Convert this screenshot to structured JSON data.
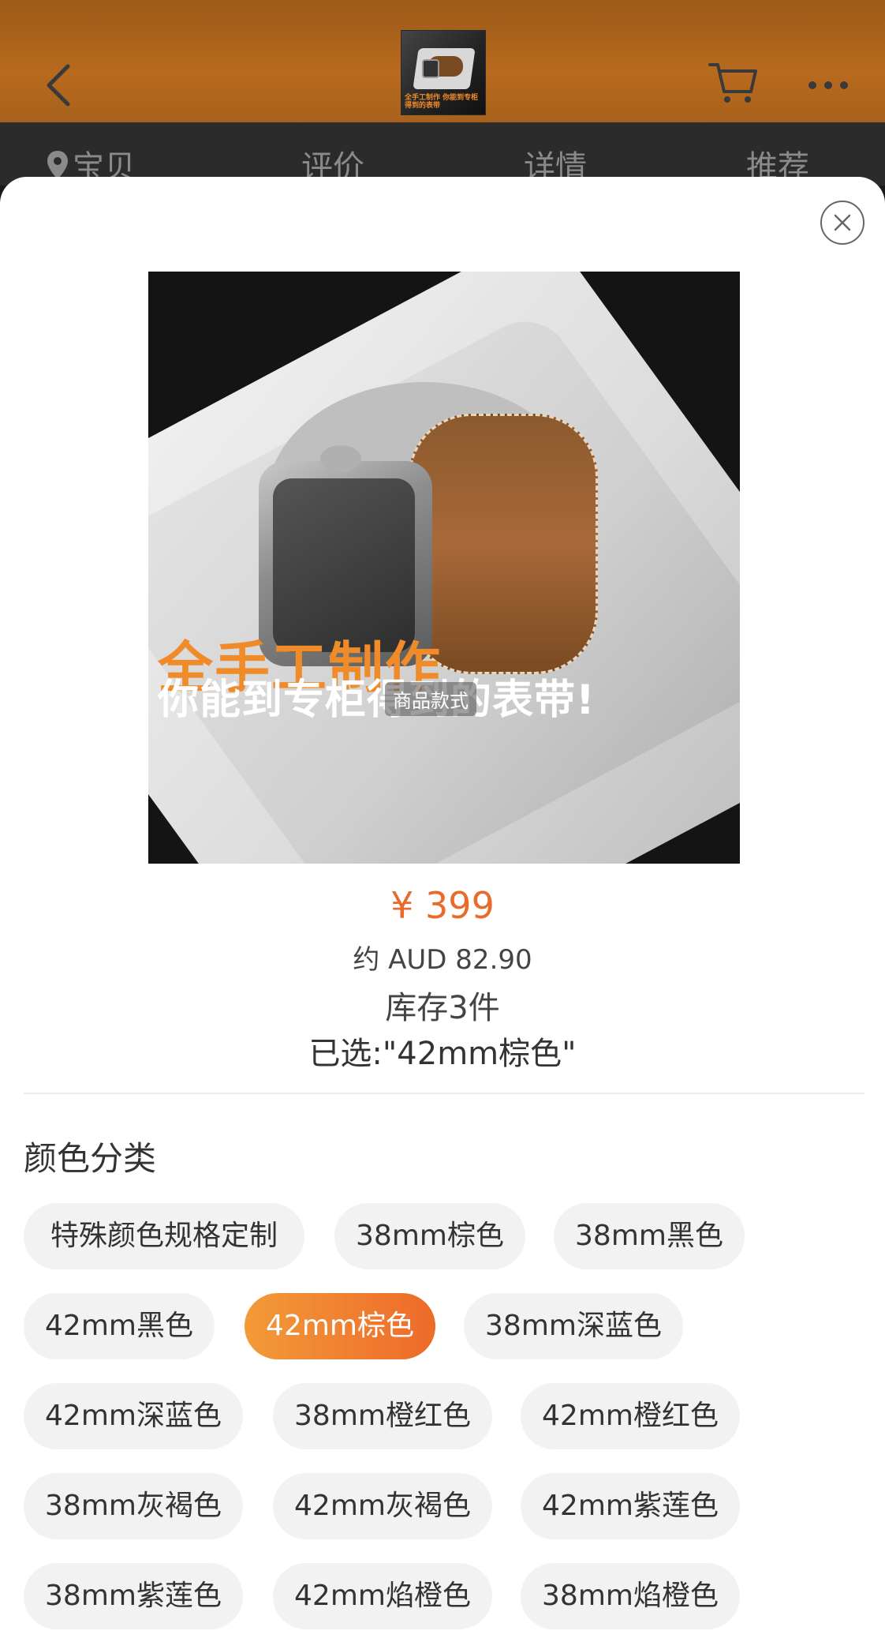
{
  "header": {
    "tabs": [
      "宝贝",
      "评价",
      "详情",
      "推荐"
    ],
    "thumbnail_caption": "全手工制作 你能到专柜得到的表带"
  },
  "product": {
    "image_slogan_line1": "全手工制作",
    "image_slogan_line2": "你能到专柜得到的表带!",
    "image_badge": "商品款式",
    "price": "¥ 399",
    "approx_price": "约 AUD 82.90",
    "stock": "库存3件",
    "selected": "已选:\"42mm棕色\""
  },
  "options": {
    "title": "颜色分类",
    "selected_index": 4,
    "items": [
      "特殊颜色规格定制",
      "38mm棕色",
      "38mm黑色",
      "42mm黑色",
      "42mm棕色",
      "38mm深蓝色",
      "42mm深蓝色",
      "38mm橙红色",
      "42mm橙红色",
      "38mm灰褐色",
      "42mm灰褐色",
      "42mm紫莲色",
      "38mm紫莲色",
      "42mm焰橙色",
      "38mm焰橙色"
    ]
  },
  "colors": {
    "accent": "#e86b2b",
    "chip_bg": "#f2f2f2",
    "chip_active_start": "#f29a38",
    "chip_active_end": "#ee6a2a"
  },
  "icons": [
    "back-icon",
    "cart-icon",
    "more-icon",
    "location-pin-icon",
    "close-icon"
  ]
}
